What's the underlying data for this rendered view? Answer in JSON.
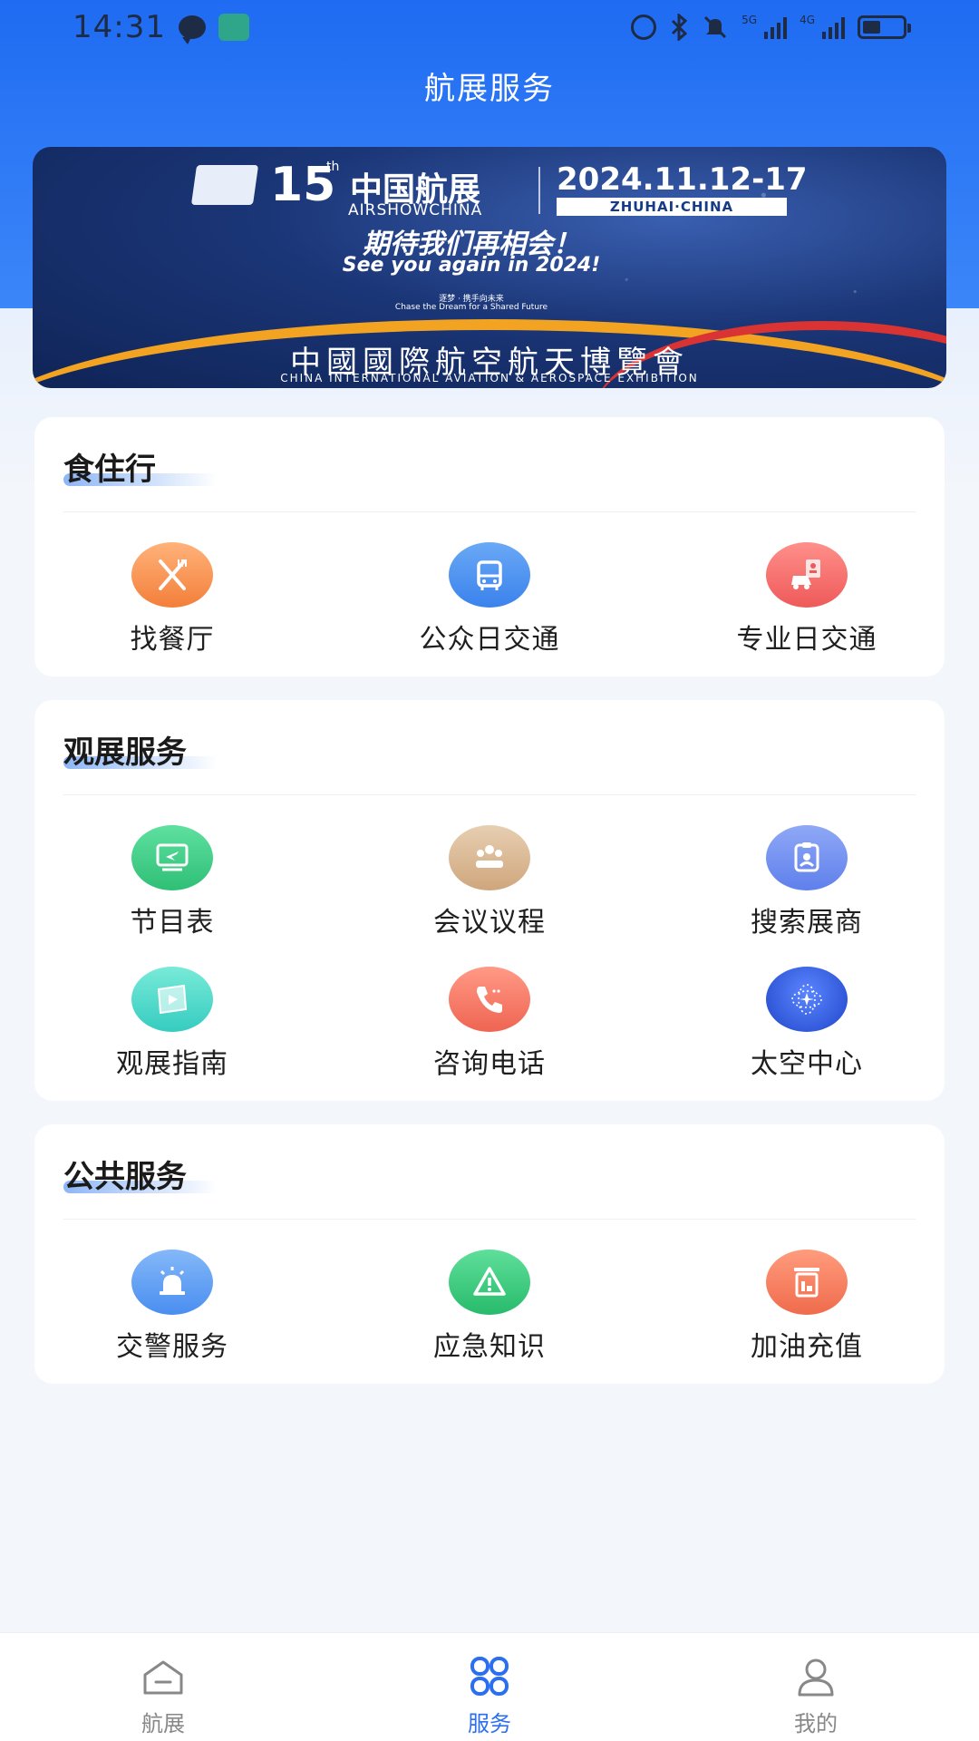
{
  "status_bar": {
    "time": "14:31",
    "app_badge": "WONLY",
    "network_left": "5G",
    "network_right": "4G",
    "battery_level": 0.45
  },
  "header": {
    "title": "航展服务"
  },
  "banner": {
    "edition": "15",
    "edition_suffix": "th",
    "title_cn": "中国航展",
    "title_en": "AIRSHOWCHINA",
    "date": "2024.11.12-17",
    "place": "ZHUHAI·CHINA",
    "slogan_cn": "期待我们再相会！",
    "slogan_en": "See you again in 2024!",
    "motto_cn": "逐梦 · 携手向未来",
    "motto_en": "Chase the Dream for a Shared Future",
    "expo_cn": "中國國際航空航天博覽會",
    "expo_en": "CHINA INTERNATIONAL AVIATION & AEROSPACE EXHIBITION"
  },
  "sections": {
    "food": {
      "title": "食住行",
      "items": [
        {
          "label": "找餐厅",
          "icon": "restaurant-icon",
          "color": "#f7924a"
        },
        {
          "label": "公众日交通",
          "icon": "bus-icon",
          "color": "#4b92f2"
        },
        {
          "label": "专业日交通",
          "icon": "vehicle-pass-icon",
          "color": "#f26c6c"
        }
      ]
    },
    "visit": {
      "title": "观展服务",
      "items": [
        {
          "label": "节目表",
          "icon": "flight-schedule-icon",
          "color": "#3fcf87"
        },
        {
          "label": "会议议程",
          "icon": "meeting-icon",
          "color": "#d9b896"
        },
        {
          "label": "搜索展商",
          "icon": "exhibitor-search-icon",
          "color": "#6f8ff2"
        },
        {
          "label": "观展指南",
          "icon": "guide-icon",
          "color": "#45d6c6"
        },
        {
          "label": "咨询电话",
          "icon": "phone-icon",
          "color": "#f47a68"
        },
        {
          "label": "太空中心",
          "icon": "space-center-icon",
          "color": "#3563e8"
        }
      ]
    },
    "public": {
      "title": "公共服务",
      "items": [
        {
          "label": "交警服务",
          "icon": "police-light-icon",
          "color": "#5b9ef2"
        },
        {
          "label": "应急知识",
          "icon": "warning-icon",
          "color": "#35c978"
        },
        {
          "label": "加油充值",
          "icon": "fuel-icon",
          "color": "#f47a5e"
        }
      ]
    }
  },
  "bottom_nav": {
    "items": [
      {
        "label": "航展",
        "icon": "home-icon"
      },
      {
        "label": "服务",
        "icon": "services-grid-icon",
        "active": true
      },
      {
        "label": "我的",
        "icon": "profile-icon"
      }
    ],
    "active_color": "#2b6ff0",
    "inactive_color": "#888888"
  }
}
